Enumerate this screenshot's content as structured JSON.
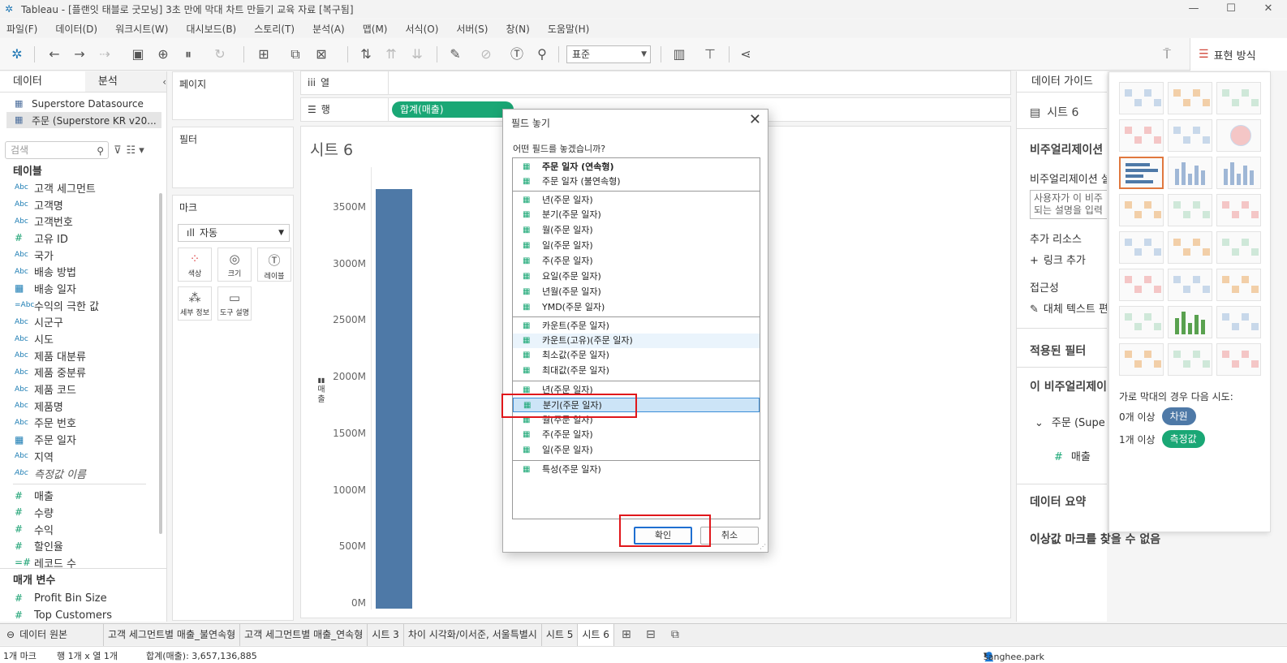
{
  "window": {
    "title": "Tableau - [플랜잇 태블로 굿모닝] 3초 만에 막대 차트 만들기 교육 자료 [복구됨]",
    "controls": [
      "—",
      "☐",
      "✕"
    ]
  },
  "menu": [
    "파일(F)",
    "데이터(D)",
    "워크시트(W)",
    "대시보드(B)",
    "스토리(T)",
    "분석(A)",
    "맵(M)",
    "서식(O)",
    "서버(S)",
    "창(N)",
    "도움말(H)"
  ],
  "toolbar": {
    "fit_select": "표준",
    "show_me_label": "표현 방식"
  },
  "left": {
    "tabs": [
      "데이터",
      "분석"
    ],
    "datasources": [
      "Superstore Datasource",
      "주문 (Superstore KR v20..."
    ],
    "search_placeholder": "검색",
    "tables_title": "테이블",
    "dimensions": [
      {
        "type": "Abc",
        "name": "고객 세그먼트"
      },
      {
        "type": "Abc",
        "name": "고객명"
      },
      {
        "type": "Abc",
        "name": "고객번호"
      },
      {
        "type": "#",
        "name": "고유 ID"
      },
      {
        "type": "Abc",
        "name": "국가"
      },
      {
        "type": "Abc",
        "name": "배송 방법"
      },
      {
        "type": "date",
        "name": "배송 일자"
      },
      {
        "type": "=Abc",
        "name": "수익의 극한 값"
      },
      {
        "type": "Abc",
        "name": "시군구"
      },
      {
        "type": "Abc",
        "name": "시도"
      },
      {
        "type": "Abc",
        "name": "제품 대분류"
      },
      {
        "type": "Abc",
        "name": "제품 중분류"
      },
      {
        "type": "Abc",
        "name": "제품 코드"
      },
      {
        "type": "Abc",
        "name": "제품명"
      },
      {
        "type": "Abc",
        "name": "주문 번호"
      },
      {
        "type": "date",
        "name": "주문 일자"
      },
      {
        "type": "Abc",
        "name": "지역"
      },
      {
        "type": "Abc",
        "name": "측정값 이름"
      }
    ],
    "measures": [
      {
        "type": "#",
        "name": "매출"
      },
      {
        "type": "#",
        "name": "수량"
      },
      {
        "type": "#",
        "name": "수익"
      },
      {
        "type": "#",
        "name": "할인율"
      },
      {
        "type": "=#",
        "name": "레코드 수"
      }
    ],
    "params_title": "매개 변수",
    "params": [
      {
        "type": "#",
        "name": "Profit Bin Size"
      },
      {
        "type": "#",
        "name": "Top Customers"
      }
    ]
  },
  "cards": {
    "pages": "페이지",
    "filters": "필터",
    "marks": "마크",
    "marks_type": "자동",
    "mark_buttons": [
      {
        "label": "색상",
        "icon": "color-icon"
      },
      {
        "label": "크기",
        "icon": "size-icon"
      },
      {
        "label": "레이블",
        "icon": "label-icon"
      },
      {
        "label": "세부 정보",
        "icon": "detail-icon"
      },
      {
        "label": "도구 설명",
        "icon": "tooltip-icon"
      }
    ]
  },
  "shelves": {
    "columns": "열",
    "rows": "행",
    "row_pill": "합계(매출)"
  },
  "viz": {
    "title": "시트 6",
    "axis_title": "매출"
  },
  "chart_data": {
    "type": "bar",
    "categories": [
      ""
    ],
    "values": [
      3657136885
    ],
    "ylim": [
      0,
      3650000000
    ],
    "ylabel": "매출",
    "yticks": [
      "3500M",
      "3000M",
      "2500M",
      "2000M",
      "1500M",
      "1000M",
      "500M",
      "0M"
    ]
  },
  "guide": {
    "header": "데이터 가이드",
    "sheet": "시트 6",
    "viz_section": "비주얼리제이션",
    "viz_desc_label": "비주얼리제이션 설",
    "desc_placeholder_1": "사용자가 이 비주",
    "desc_placeholder_2": "되는 설명을 입력",
    "resources": "추가 리소스",
    "add_link": "링크 추가",
    "accessibility": "접근성",
    "alt_text": "대체 텍스트 편",
    "applied_filters": "적용된 필터",
    "this_viz": "이 비주얼리제이",
    "source": "주문 (Supe",
    "measure": "매출",
    "data_summary": "데이터 요약",
    "outliers": "이상값 마크를 찾을 수 없음"
  },
  "showme": {
    "hint": "가로 막대의 경우 다음 시도:",
    "rows": [
      {
        "prefix": "0개 이상",
        "badge": "차원",
        "color": "#4e79a7"
      },
      {
        "prefix": "1개 이상",
        "badge": "측정값",
        "color": "#1aa775"
      }
    ],
    "thumb_names": [
      "text-table",
      "heat-map",
      "highlight-table",
      "symbol-map",
      "filled-map",
      "pie-chart",
      "horizontal-bars",
      "stacked-bars",
      "side-by-side-bars",
      "treemap",
      "circle-view",
      "side-by-side-circles",
      "lines-continuous",
      "lines-discrete",
      "dual-lines",
      "area-continuous",
      "area-discrete",
      "dual-combination",
      "scatter-plot",
      "histogram",
      "box-and-whisker",
      "gantt-chart",
      "bullet-graph",
      "packed-bubbles"
    ]
  },
  "dialog": {
    "title": "필드 놓기",
    "question": "어떤 필드를 놓겠습니까?",
    "options": [
      {
        "label": "주문 일자 (연속형)",
        "bold": true
      },
      {
        "label": "주문 일자 (불연속형)"
      },
      {
        "label": "년(주문 일자)"
      },
      {
        "label": "분기(주문 일자)"
      },
      {
        "label": "월(주문 일자)"
      },
      {
        "label": "일(주문 일자)"
      },
      {
        "label": "주(주문 일자)"
      },
      {
        "label": "요일(주문 일자)"
      },
      {
        "label": "년월(주문 일자)"
      },
      {
        "label": "YMD(주문 일자)"
      },
      {
        "label": "카운트(주문 일자)"
      },
      {
        "label": "카운트(고유)(주문 일자)"
      },
      {
        "label": "최소값(주문 일자)"
      },
      {
        "label": "최대값(주문 일자)"
      },
      {
        "label": "년(주문 일자)"
      },
      {
        "label": "분기(주문 일자)"
      },
      {
        "label": "월(주문 일자)"
      },
      {
        "label": "주(주문 일자)"
      },
      {
        "label": "일(주문 일자)"
      },
      {
        "label": "특성(주문 일자)"
      }
    ],
    "ok": "확인",
    "cancel": "취소"
  },
  "tabs": [
    "고객 세그먼트별 매출_불연속형",
    "고객 세그먼트별 매출_연속형",
    "시트 3",
    "차이 시각화/이서준, 서울특별시",
    "시트 5",
    "시트 6"
  ],
  "tab_datasource": "데이터 원본",
  "status": {
    "marks": "1개 마크",
    "rows_cols": "행 1개 x 열 1개",
    "sum": "합계(매출): 3,657,136,885",
    "user": "sanghee.park"
  }
}
